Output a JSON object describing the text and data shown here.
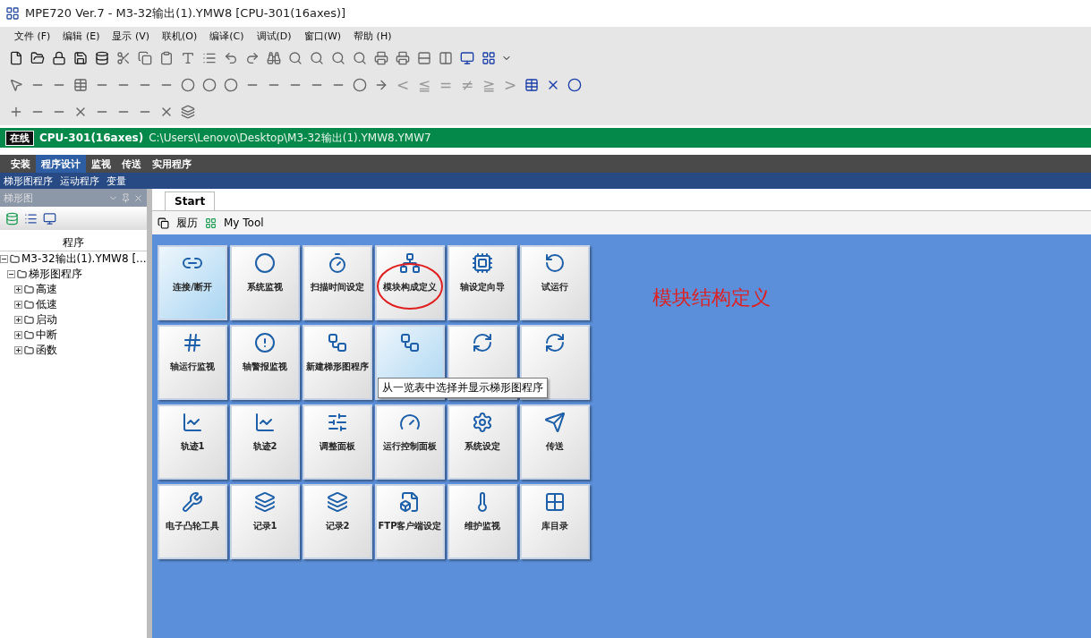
{
  "window": {
    "title": "MPE720 Ver.7 - M3-32输出(1).YMW8 [CPU-301(16axes)]"
  },
  "menu": [
    "文件 (F)",
    "编辑 (E)",
    "显示 (V)",
    "联机(O)",
    "编译(C)",
    "调试(D)",
    "窗口(W)",
    "帮助 (H)"
  ],
  "compare_buttons": [
    "<",
    "≦",
    "=",
    "≠",
    "≧",
    ">"
  ],
  "status": {
    "mode": "在线",
    "cpu": "CPU-301(16axes)",
    "path": "C:\\Users\\Lenovo\\Desktop\\M3-32输出(1).YMW8.YMW7"
  },
  "ribbon_tabs": [
    {
      "label": "安装",
      "selected": false
    },
    {
      "label": "程序设计",
      "selected": true
    },
    {
      "label": "监视",
      "selected": false
    },
    {
      "label": "传送",
      "selected": false
    },
    {
      "label": "实用程序",
      "selected": false
    }
  ],
  "sub_tabs": [
    "梯形图程序",
    "运动程序",
    "变量"
  ],
  "panel": {
    "title": "梯形图",
    "column": "程序",
    "tree": [
      {
        "label": "M3-32输出(1).YMW8 [...",
        "expanded": true,
        "children": [
          {
            "label": "梯形图程序",
            "expanded": true,
            "children": [
              {
                "label": "高速",
                "expanded": false
              },
              {
                "label": "低速",
                "expanded": false
              },
              {
                "label": "启动",
                "expanded": false
              },
              {
                "label": "中断",
                "expanded": false
              },
              {
                "label": "函数",
                "expanded": false
              }
            ]
          }
        ]
      }
    ]
  },
  "doc_tab": {
    "label": "Start",
    "selected": true
  },
  "start_toolbar": [
    "履历",
    "My Tool"
  ],
  "tiles": [
    [
      {
        "label": "连接/断开",
        "highlighted": true,
        "circled": false
      },
      {
        "label": "系统监视",
        "highlighted": false,
        "circled": false
      },
      {
        "label": "扫描时间设定",
        "highlighted": false,
        "circled": false
      },
      {
        "label": "模块构成定义",
        "highlighted": false,
        "circled": true
      },
      {
        "label": "轴设定向导",
        "highlighted": false,
        "circled": false
      },
      {
        "label": "试运行",
        "highlighted": false,
        "circled": false
      }
    ],
    [
      {
        "label": "轴运行监视",
        "highlighted": false,
        "circled": false
      },
      {
        "label": "轴警报监视",
        "highlighted": false,
        "circled": false
      },
      {
        "label": "新建梯形图程序",
        "highlighted": false,
        "circled": false
      },
      {
        "highlighted": true,
        "circled": false
      },
      {
        "highlighted": false,
        "circled": false
      },
      {
        "highlighted": false,
        "circled": false
      }
    ],
    [
      {
        "label": "轨迹1",
        "highlighted": false,
        "circled": false
      },
      {
        "label": "轨迹2",
        "highlighted": false,
        "circled": false
      },
      {
        "label": "调整面板",
        "highlighted": false,
        "circled": false
      },
      {
        "label": "运行控制面板",
        "highlighted": false,
        "circled": false
      },
      {
        "label": "系统设定",
        "highlighted": false,
        "circled": false
      },
      {
        "label": "传送",
        "highlighted": false,
        "circled": false
      }
    ],
    [
      {
        "label": "电子凸轮工具",
        "highlighted": false,
        "circled": false
      },
      {
        "label": "记录1",
        "highlighted": false,
        "circled": false
      },
      {
        "label": "记录2",
        "highlighted": false,
        "circled": false
      },
      {
        "label": "FTP客户端设定",
        "highlighted": false,
        "circled": false
      },
      {
        "label": "维护监视",
        "highlighted": false,
        "circled": false
      },
      {
        "label": "库目录",
        "highlighted": false,
        "circled": false
      }
    ]
  ],
  "tooltip": "从一览表中选择并显示梯形图程序",
  "annotation": {
    "text": "模块结构定义"
  }
}
